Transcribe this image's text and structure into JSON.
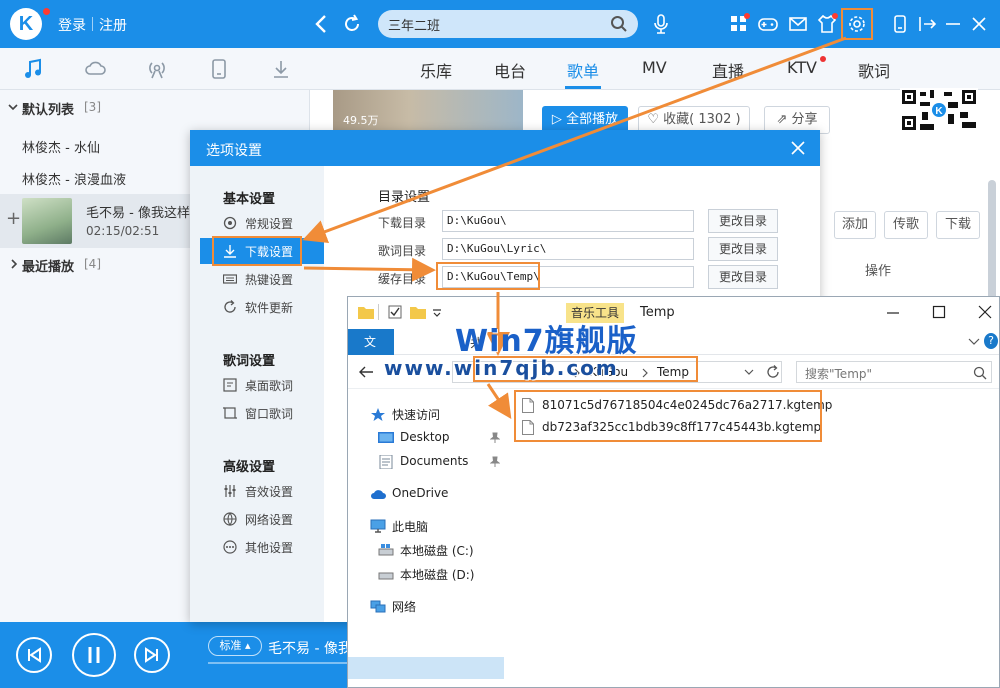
{
  "top_bar": {
    "login_label": "登录",
    "register_label": "注册",
    "search_value": "三年二班",
    "icons": [
      "back-icon",
      "refresh-icon",
      "search-icon",
      "mic-icon",
      "apps-icon",
      "game-icon",
      "mail-icon",
      "skin-icon",
      "settings-icon",
      "mini-mode-icon",
      "exit-icon",
      "minimize-icon",
      "close-icon"
    ]
  },
  "nav_tabs": [
    {
      "label": "乐库"
    },
    {
      "label": "电台"
    },
    {
      "label": "歌单"
    },
    {
      "label": "MV"
    },
    {
      "label": "直播"
    },
    {
      "label": "KTV"
    },
    {
      "label": "歌词"
    }
  ],
  "sidebar": {
    "default_list_label": "默认列表",
    "default_list_count": "[3]",
    "songs": [
      "林俊杰 - 水仙",
      "林俊杰 - 浪漫血液"
    ],
    "now_playing": {
      "title": "毛不易 - 像我这样",
      "time": "02:15/02:51"
    },
    "recent_label": "最近播放",
    "recent_count": "[4]"
  },
  "content": {
    "play_count": "49.5万",
    "play_all_label": "全部播放",
    "favorite_label": "收藏( 1302 )",
    "share_label": "分享",
    "add_label": "添加",
    "send_label": "传歌",
    "download_label": "下载",
    "operation_header": "操作"
  },
  "dialog": {
    "title": "选项设置",
    "nav": {
      "basic_heading": "基本设置",
      "basic_items": [
        "常规设置",
        "下载设置",
        "热键设置",
        "软件更新"
      ],
      "lyric_heading": "歌词设置",
      "lyric_items": [
        "桌面歌词",
        "窗口歌词"
      ],
      "advanced_heading": "高级设置",
      "advanced_items": [
        "音效设置",
        "网络设置",
        "其他设置"
      ]
    },
    "directory_heading": "目录设置",
    "directories": [
      {
        "label": "下载目录",
        "value": "D:\\KuGou\\",
        "button": "更改目录"
      },
      {
        "label": "歌词目录",
        "value": "D:\\KuGou\\Lyric\\",
        "button": "更改目录"
      },
      {
        "label": "缓存目录",
        "value": "D:\\KuGou\\Temp\\",
        "button": "更改目录"
      }
    ]
  },
  "explorer": {
    "ribbon_tool_label": "音乐工具",
    "window_title": "Temp",
    "ribbon_file_tab": "文",
    "ribbon_share_fragment": "共",
    "path_segments": [
      "KuGou",
      "Temp"
    ],
    "search_placeholder": "搜索\"Temp\"",
    "nav_items": [
      {
        "label": "快速访问",
        "icon": "star-icon"
      },
      {
        "label": "Desktop",
        "icon": "desktop-folder-icon"
      },
      {
        "label": "Documents",
        "icon": "documents-folder-icon"
      },
      {
        "label": "OneDrive",
        "icon": "cloud-icon"
      },
      {
        "label": "此电脑",
        "icon": "computer-icon"
      },
      {
        "label": "本地磁盘 (C:)",
        "icon": "drive-icon"
      },
      {
        "label": "本地磁盘 (D:)",
        "icon": "drive-icon"
      },
      {
        "label": "网络",
        "icon": "network-icon"
      }
    ],
    "files": [
      "81071c5d76718504c4e0245dc76a2717.kgtemp",
      "db723af325cc1bdb39c8ff177c45443b.kgtemp"
    ]
  },
  "bottom_bar": {
    "quality_label": "标准",
    "song_label": "毛不易 - 像我"
  },
  "watermark": {
    "logo_text": "Win7旗舰版",
    "url": "www.win7qjb.com"
  },
  "colors": {
    "accent": "#1b8ee8",
    "annotation": "#f08c38"
  }
}
